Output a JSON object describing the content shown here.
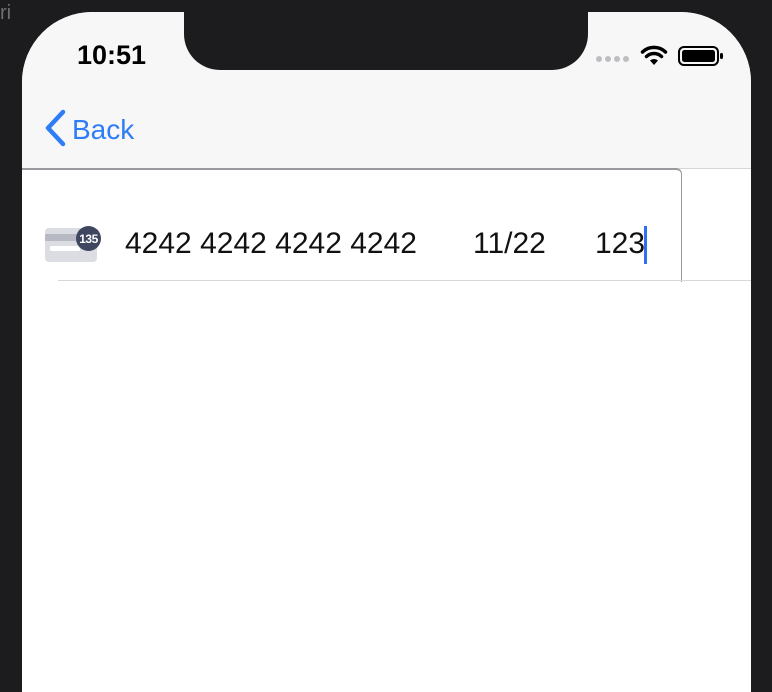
{
  "background_label": "ri",
  "status_bar": {
    "time": "10:51",
    "icons": [
      "signal-dots-icon",
      "wifi-icon",
      "battery-icon"
    ]
  },
  "nav": {
    "back_label": "Back",
    "back_icon": "chevron-left-icon"
  },
  "card_field": {
    "number": "4242 4242 4242 4242",
    "expiry": "11/22",
    "cvc": "123",
    "brand_badge": "135",
    "brand_icon": "credit-card-icon"
  },
  "colors": {
    "accent": "#2f7df6",
    "caret": "#2f6ff2",
    "background": "#1c1c1e",
    "nav_bar": "#f7f7f7"
  }
}
